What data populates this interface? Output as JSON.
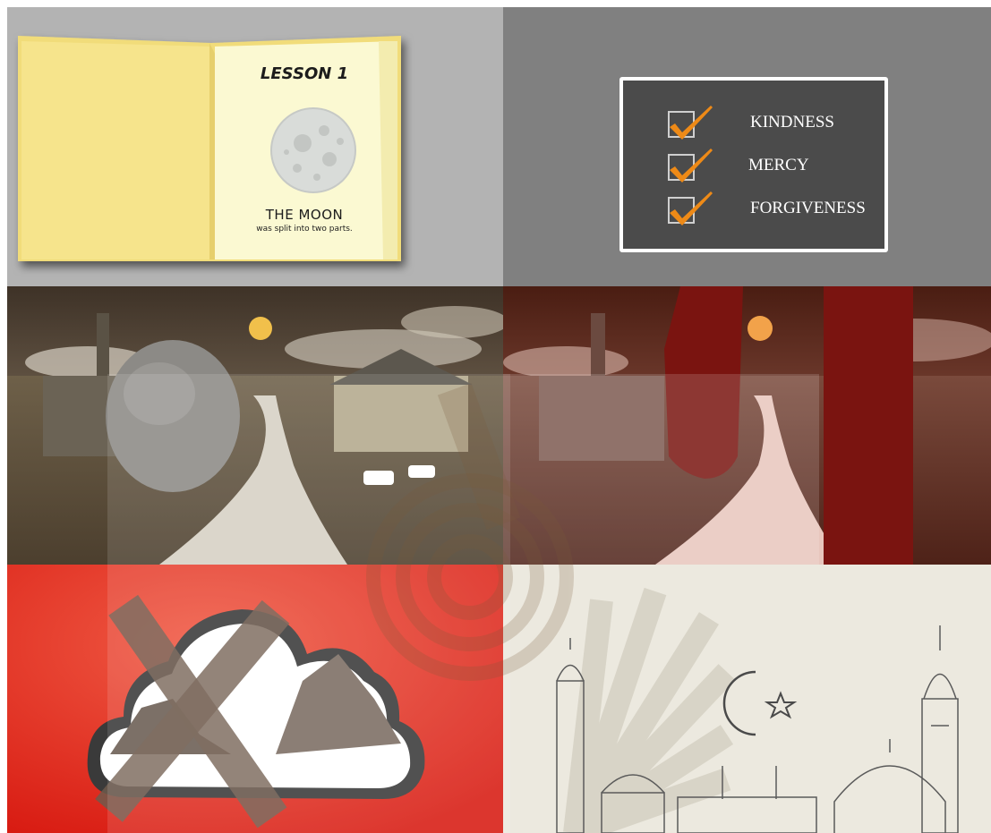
{
  "panels": {
    "lesson_book": {
      "title": "LESSON 1",
      "moon_label": "THE MOON",
      "moon_caption": "was split into two parts.",
      "background": "#b3b3b3",
      "page_color": "#fbf9d2",
      "cover_color": "#f6e48c"
    },
    "checklist": {
      "items": [
        {
          "label": "KINDNESS"
        },
        {
          "label": "MERCY"
        },
        {
          "label": "FORGIVENESS"
        }
      ],
      "background": "#808080",
      "board_color": "#4b4b4b",
      "check_color": "#ee8a17"
    },
    "landscape_rock": {
      "tone": "sepia",
      "sun_color": "#f1c04b"
    },
    "landscape_pillars": {
      "tone": "red",
      "pillar_color": "#7a1410"
    },
    "cloud_mountain": {
      "background": "#e0241a"
    },
    "mosque_sketch": {
      "background": "#ece9df"
    }
  }
}
